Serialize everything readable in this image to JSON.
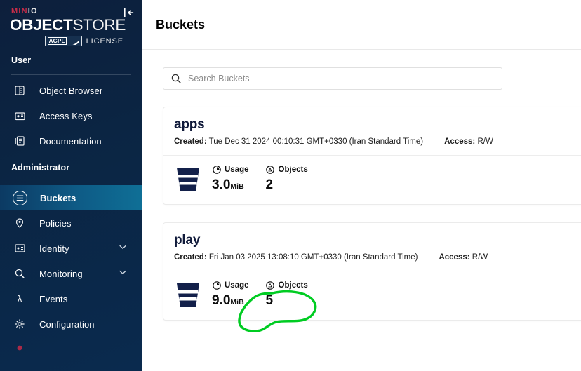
{
  "sidebar": {
    "logo": {
      "brand_min": "MIN",
      "brand_io": "IO",
      "object": "OBJECT",
      "store": "STORE",
      "badge": "AGPL",
      "license": "LICENSE"
    },
    "collapse_icon": "collapse-sidebar-icon",
    "sections": [
      {
        "label": "User",
        "items": [
          {
            "label": "Object Browser",
            "icon": "object-browser-icon",
            "active": false,
            "chevron": false
          },
          {
            "label": "Access Keys",
            "icon": "access-keys-icon",
            "active": false,
            "chevron": false
          },
          {
            "label": "Documentation",
            "icon": "documentation-icon",
            "active": false,
            "chevron": false
          }
        ]
      },
      {
        "label": "Administrator",
        "items": [
          {
            "label": "Buckets",
            "icon": "buckets-icon",
            "active": true,
            "chevron": false
          },
          {
            "label": "Policies",
            "icon": "policies-icon",
            "active": false,
            "chevron": false
          },
          {
            "label": "Identity",
            "icon": "identity-icon",
            "active": false,
            "chevron": true
          },
          {
            "label": "Monitoring",
            "icon": "monitoring-icon",
            "active": false,
            "chevron": true
          },
          {
            "label": "Events",
            "icon": "events-lambda-icon",
            "active": false,
            "chevron": false
          },
          {
            "label": "Configuration",
            "icon": "configuration-gear-icon",
            "active": false,
            "chevron": false
          }
        ]
      }
    ]
  },
  "header": {
    "title": "Buckets"
  },
  "search": {
    "placeholder": "Search Buckets",
    "value": "",
    "icon": "search-icon"
  },
  "buckets": [
    {
      "name": "apps",
      "created_label": "Created:",
      "created_value": "Tue Dec 31 2024 00:10:31 GMT+0330 (Iran Standard Time)",
      "access_label": "Access:",
      "access_value": "R/W",
      "usage_label": "Usage",
      "usage_value": "3.0",
      "usage_unit": "MiB",
      "objects_label": "Objects",
      "objects_value": "2"
    },
    {
      "name": "play",
      "created_label": "Created:",
      "created_value": "Fri Jan 03 2025 13:08:10 GMT+0330 (Iran Standard Time)",
      "access_label": "Access:",
      "access_value": "R/W",
      "usage_label": "Usage",
      "usage_value": "9.0",
      "usage_unit": "MiB",
      "objects_label": "Objects",
      "objects_value": "5"
    }
  ],
  "annotation": {
    "type": "hand-drawn-circle",
    "color": "#00cc22",
    "target": "objects-stat-of-play-bucket"
  },
  "colors": {
    "sidebar_dark": "#0d1f3c",
    "sidebar_active": "#0f6f96",
    "brand_red": "#c72c48",
    "bucket_navy": "#13204a",
    "annotation_green": "#00cc22"
  }
}
